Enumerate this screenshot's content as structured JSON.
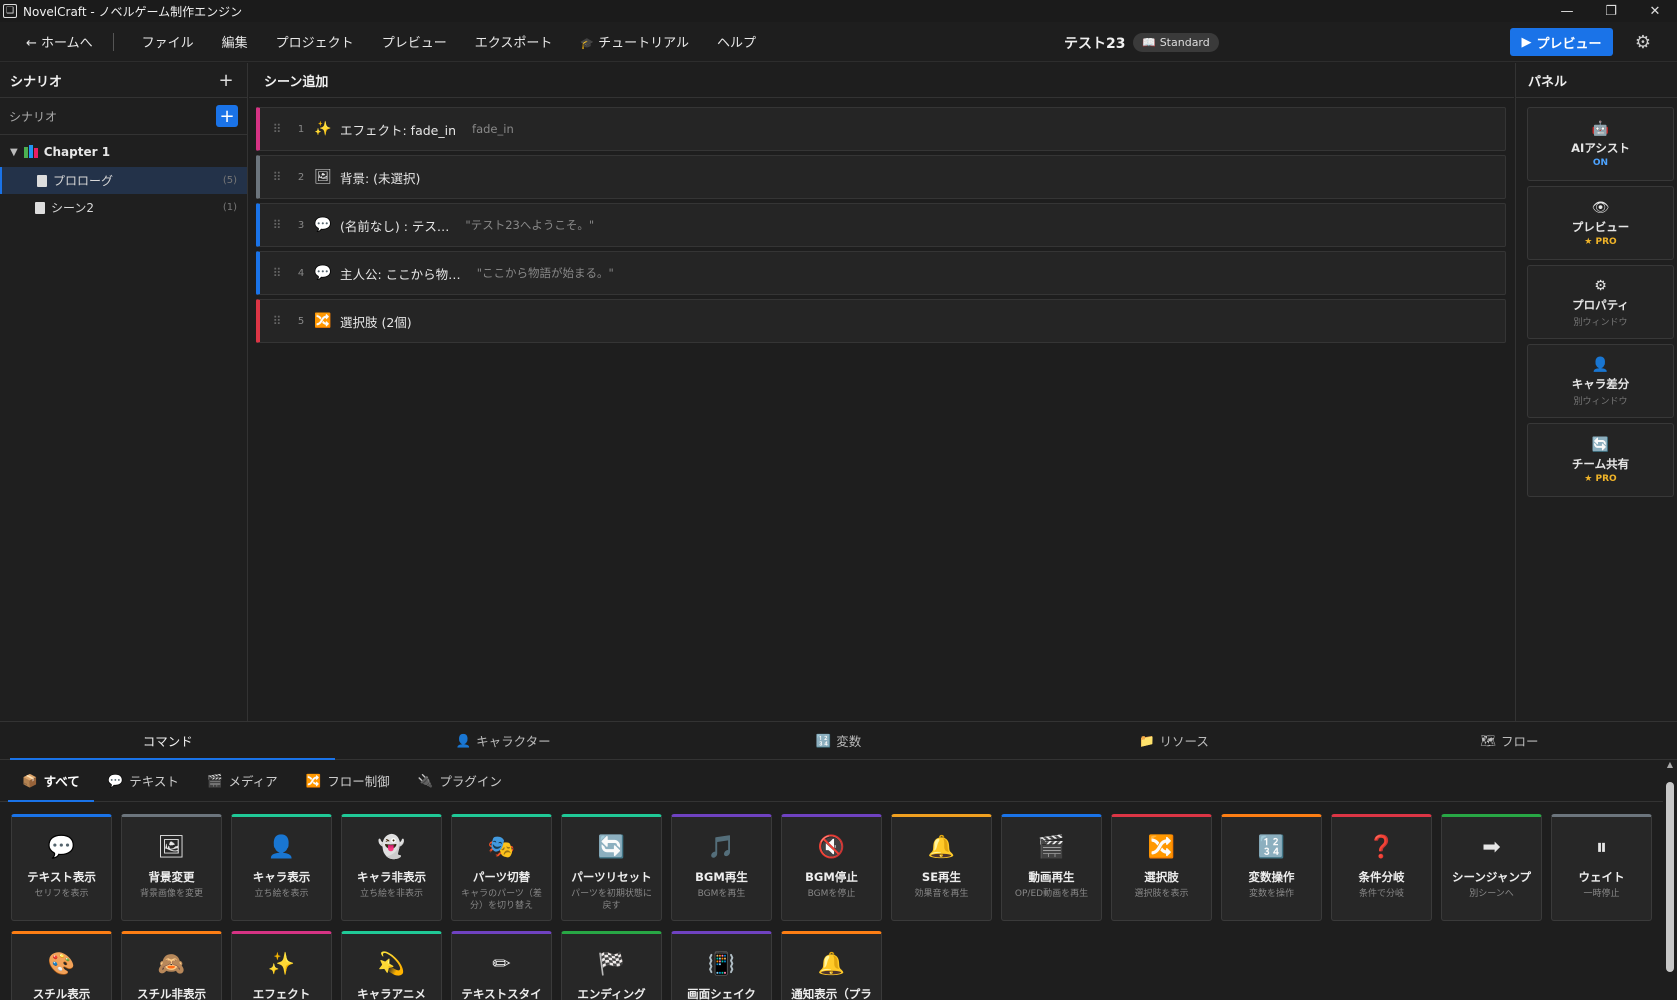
{
  "window": {
    "title": "NovelCraft - ノベルゲーム制作エンジン"
  },
  "menubar": {
    "home": "← ホームへ",
    "items": [
      "ファイル",
      "編集",
      "プロジェクト",
      "プレビュー",
      "エクスポート",
      "チュートリアル",
      "ヘルプ"
    ],
    "project_title": "テスト23",
    "edition_badge": "Standard",
    "preview_button": "プレビュー"
  },
  "sidebar": {
    "header": "シナリオ",
    "sub_label": "シナリオ",
    "chapter": "Chapter 1",
    "scenes": [
      {
        "label": "プロローグ",
        "count": "(5)"
      },
      {
        "label": "シーン2",
        "count": "(1)"
      }
    ]
  },
  "main": {
    "header": "シーン追加",
    "commands": [
      {
        "num": "1",
        "icon": "✨",
        "label": "エフェクト: fade_in",
        "sub": "fade_in",
        "color": "#d63384"
      },
      {
        "num": "2",
        "icon": "🖼",
        "label": "背景: (未選択)",
        "sub": "",
        "color": "#6c757d"
      },
      {
        "num": "3",
        "icon": "💬",
        "label": "(名前なし) : テス…",
        "sub": "\"テスト23へようこそ。\"",
        "color": "#1a73e8"
      },
      {
        "num": "4",
        "icon": "💬",
        "label": "主人公: ここから物…",
        "sub": "\"ここから物語が始まる。\"",
        "color": "#1a73e8"
      },
      {
        "num": "5",
        "icon": "🔀",
        "label": "選択肢 (2個)",
        "sub": "",
        "color": "#dc3545"
      }
    ]
  },
  "panel": {
    "header": "パネル",
    "cards": [
      {
        "icon": "🤖",
        "label": "AIアシスト",
        "sub": "ON",
        "kind": "on"
      },
      {
        "icon": "👁",
        "label": "プレビュー",
        "sub": "★ PRO",
        "kind": "pro"
      },
      {
        "icon": "⚙",
        "label": "プロパティ",
        "sub": "別ウィンドウ",
        "kind": "plain"
      },
      {
        "icon": "👤",
        "label": "キャラ差分",
        "sub": "別ウィンドウ",
        "kind": "plain"
      },
      {
        "icon": "🔄",
        "label": "チーム共有",
        "sub": "★ PRO",
        "kind": "pro"
      }
    ]
  },
  "bottom": {
    "tabs": [
      {
        "icon": "",
        "label": "コマンド"
      },
      {
        "icon": "👤",
        "label": "キャラクター"
      },
      {
        "icon": "🔢",
        "label": "変数"
      },
      {
        "icon": "📁",
        "label": "リソース"
      },
      {
        "icon": "🗺",
        "label": "フロー"
      }
    ],
    "categories": [
      {
        "icon": "📦",
        "label": "すべて"
      },
      {
        "icon": "💬",
        "label": "テキスト"
      },
      {
        "icon": "🎬",
        "label": "メディア"
      },
      {
        "icon": "🔀",
        "label": "フロー制御"
      },
      {
        "icon": "🔌",
        "label": "プラグイン"
      }
    ],
    "command_cards": [
      {
        "icon": "💬",
        "label": "テキスト表示",
        "sub": "セリフを表示",
        "color": "#1a73e8"
      },
      {
        "icon": "🖼",
        "label": "背景変更",
        "sub": "背景画像を変更",
        "color": "#6c757d"
      },
      {
        "icon": "👤",
        "label": "キャラ表示",
        "sub": "立ち絵を表示",
        "color": "#20c997"
      },
      {
        "icon": "👻",
        "label": "キャラ非表示",
        "sub": "立ち絵を非表示",
        "color": "#20c997"
      },
      {
        "icon": "🎭",
        "label": "パーツ切替",
        "sub": "キャラのパーツ（差分）を切り替え",
        "color": "#20c997"
      },
      {
        "icon": "🔄",
        "label": "パーツリセット",
        "sub": "パーツを初期状態に戻す",
        "color": "#20c997"
      },
      {
        "icon": "🎵",
        "label": "BGM再生",
        "sub": "BGMを再生",
        "color": "#6f42c1"
      },
      {
        "icon": "🔇",
        "label": "BGM停止",
        "sub": "BGMを停止",
        "color": "#6f42c1"
      },
      {
        "icon": "🔔",
        "label": "SE再生",
        "sub": "効果音を再生",
        "color": "#f0a020"
      },
      {
        "icon": "🎬",
        "label": "動画再生",
        "sub": "OP/ED動画を再生",
        "color": "#1a73e8"
      },
      {
        "icon": "🔀",
        "label": "選択肢",
        "sub": "選択肢を表示",
        "color": "#dc3545"
      },
      {
        "icon": "🔢",
        "label": "変数操作",
        "sub": "変数を操作",
        "color": "#fd7e14"
      },
      {
        "icon": "❓",
        "label": "条件分岐",
        "sub": "条件で分岐",
        "color": "#dc3545"
      },
      {
        "icon": "➡",
        "label": "シーンジャンプ",
        "sub": "別シーンへ",
        "color": "#28a745"
      },
      {
        "icon": "⏸",
        "label": "ウェイト",
        "sub": "一時停止",
        "color": "#6c757d"
      },
      {
        "icon": "🎨",
        "label": "スチル表示",
        "sub": "",
        "color": "#fd7e14"
      },
      {
        "icon": "🙈",
        "label": "スチル非表示",
        "sub": "",
        "color": "#fd7e14"
      },
      {
        "icon": "✨",
        "label": "エフェクト",
        "sub": "",
        "color": "#d63384"
      },
      {
        "icon": "💫",
        "label": "キャラアニメ",
        "sub": "",
        "color": "#20c997"
      },
      {
        "icon": "✏",
        "label": "テキストスタイ",
        "sub": "",
        "color": "#6f42c1"
      },
      {
        "icon": "🏁",
        "label": "エンディング",
        "sub": "",
        "color": "#28a745"
      },
      {
        "icon": "📳",
        "label": "画面シェイク",
        "sub": "",
        "color": "#6f42c1"
      },
      {
        "icon": "🔔",
        "label": "通知表示（プラ",
        "sub": "",
        "color": "#fd7e14"
      }
    ]
  }
}
